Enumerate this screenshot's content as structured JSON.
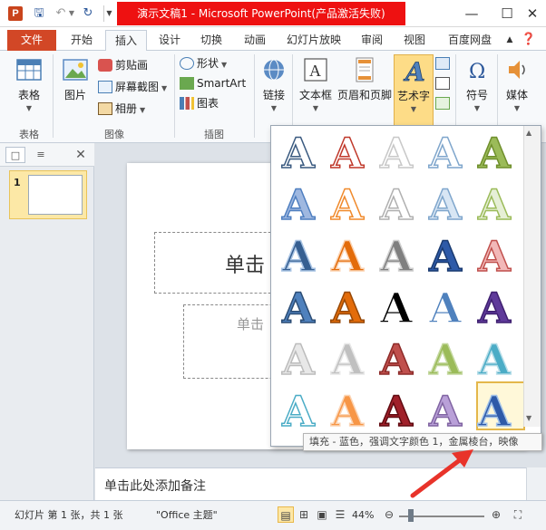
{
  "titlebar": {
    "app_icon": "P",
    "title": "演示文稿1 - Microsoft PowerPoint(产品激活失败)",
    "icons": {
      "save": "save-icon",
      "undo": "undo-icon",
      "redo": "redo-icon"
    }
  },
  "tabs": {
    "file": "文件",
    "home": "开始",
    "insert": "插入",
    "design": "设计",
    "transitions": "切换",
    "animations": "动画",
    "slideshow": "幻灯片放映",
    "review": "审阅",
    "view": "视图",
    "baidu": "百度网盘"
  },
  "ribbon": {
    "groups": {
      "table": "表格",
      "images": "图像",
      "illustrations": "插图"
    },
    "buttons": {
      "table": "表格",
      "picture": "图片",
      "clipart": "剪贴画",
      "screenshot": "屏幕截图",
      "album": "相册",
      "shapes": "形状",
      "smartart": "SmartArt",
      "chart": "图表",
      "link": "链接",
      "textbox": "文本框",
      "header_footer": "页眉和页脚",
      "wordart": "艺术字",
      "symbol": "符号",
      "media": "媒体"
    }
  },
  "thumbnail": {
    "number": "1"
  },
  "slide": {
    "title_placeholder": "单击",
    "subtitle_placeholder": "单击"
  },
  "notes": {
    "placeholder": "单击此处添加备注"
  },
  "statusbar": {
    "slide_info": "幻灯片 第 1 张，共 1 张",
    "theme": "\"Office 主题\"",
    "zoom": "44%",
    "zoom_level": 0.14
  },
  "wordart": {
    "tooltip": "填充 - 蓝色，强调文字颜色 1，金属棱台，映像",
    "glyph": "A",
    "styles": [
      {
        "fill": "#ffffff",
        "stroke": "#3a5a80"
      },
      {
        "fill": "#ffffff",
        "stroke": "#c0392b"
      },
      {
        "fill": "#ffffff",
        "stroke": "#c8c8c8"
      },
      {
        "fill": "#ffffff",
        "stroke": "#7fa6cc"
      },
      {
        "fill": "#9bbb59",
        "stroke": "#6f8f2c"
      },
      {
        "fill": "#9fb8e0",
        "stroke": "#4f7fc0"
      },
      {
        "fill": "#ffffff",
        "stroke": "#f08a2c"
      },
      {
        "fill": "#ffffff",
        "stroke": "#b0b0b0"
      },
      {
        "fill": "#d8e6f4",
        "stroke": "#7fa6cc"
      },
      {
        "fill": "#e6efd6",
        "stroke": "#9bbb59"
      },
      {
        "fill": "#365f91",
        "stroke": "#a9c4e4"
      },
      {
        "fill": "#e36c0a",
        "stroke": "#fbd4b4"
      },
      {
        "fill": "#7f7f7f",
        "stroke": "#d0d0d0"
      },
      {
        "fill": "#2e5aa8",
        "stroke": "#1a3a70"
      },
      {
        "fill": "#f2b8b8",
        "stroke": "#c0504d"
      },
      {
        "fill": "#4f81bd",
        "stroke": "#2c4d75"
      },
      {
        "fill": "#e36c0a",
        "stroke": "#974806"
      },
      {
        "fill": "#000000",
        "stroke": "#ffffff"
      },
      {
        "fill": "#4f81bd",
        "stroke": "#ffffff"
      },
      {
        "fill": "#5f3a9a",
        "stroke": "#3f2070"
      },
      {
        "fill": "#e8e8e8",
        "stroke": "#bcbcbc"
      },
      {
        "fill": "#c0c0c0",
        "stroke": "#e8e8e8"
      },
      {
        "fill": "#c0504d",
        "stroke": "#8c2a28"
      },
      {
        "fill": "#9bbb59",
        "stroke": "#c4d8a0"
      },
      {
        "fill": "#4bacc6",
        "stroke": "#b6dde8"
      },
      {
        "fill": "#ffffff",
        "stroke": "#4bacc6"
      },
      {
        "fill": "#f79646",
        "stroke": "#fbd4b4"
      },
      {
        "fill": "#a0202a",
        "stroke": "#600a10"
      },
      {
        "fill": "#b9a0d8",
        "stroke": "#8064a2"
      },
      {
        "fill": "#2e5aa8",
        "stroke": "#9fc0e8"
      }
    ]
  }
}
